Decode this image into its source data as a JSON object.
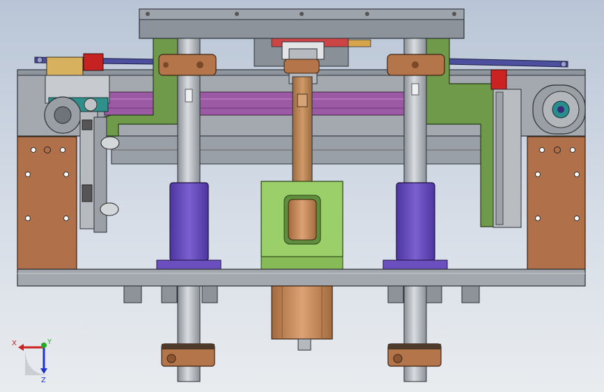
{
  "viewport": {
    "background_top": "#b9c5d6",
    "background_bottom": "#e9ecef"
  },
  "colors": {
    "steel_gray": "#8d939b",
    "frame_gray": "#a3a8ae",
    "green_plate": "#6f9a4a",
    "magenta_rail": "#9b5aa3",
    "bronze_block": "#b5754a",
    "bronze_rod": "#c08a5b",
    "purple_bearing": "#6b4fbf",
    "lime_block": "#9bcf6a",
    "red_marker": "#cc2222",
    "blue_link": "#4a4fa0"
  },
  "triad": {
    "x_label": "X",
    "y_label": "Y",
    "z_label": "Z",
    "x_color": "#cc2222",
    "y_color": "#22aa22",
    "z_color": "#2233cc"
  }
}
